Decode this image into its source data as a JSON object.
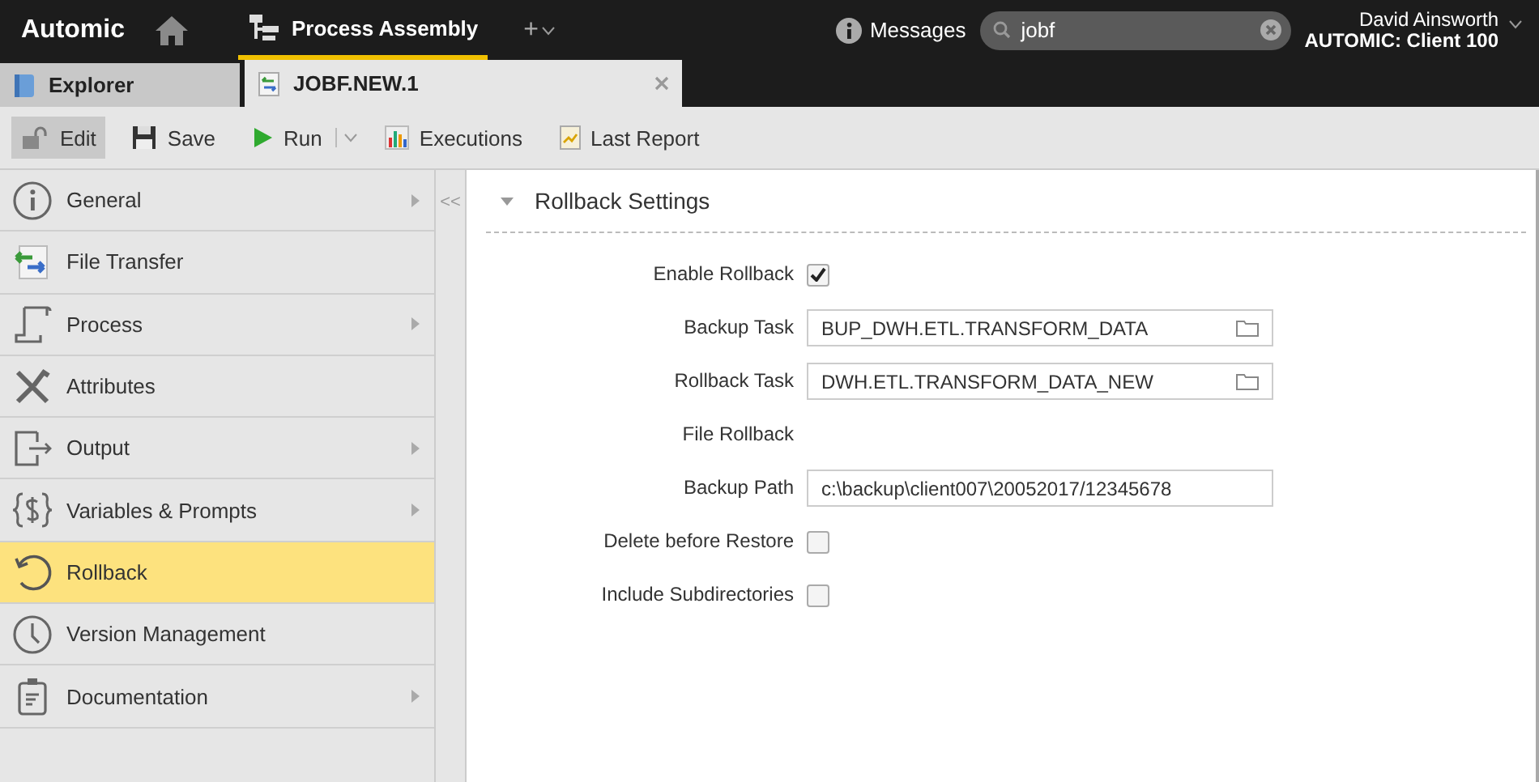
{
  "topbar": {
    "logo": "Automic",
    "perspective": "Process Assembly",
    "add": "+",
    "messages": "Messages",
    "search": {
      "value": "jobf"
    },
    "user": {
      "name": "David Ainsworth",
      "client": "AUTOMIC: Client 100"
    }
  },
  "tabs": [
    {
      "label": "Explorer",
      "selected": false,
      "closable": false
    },
    {
      "label": "JOBF.NEW.1",
      "selected": true,
      "closable": true
    }
  ],
  "toolbar": [
    {
      "label": "Edit",
      "selected": true,
      "dropdown": false
    },
    {
      "label": "Save",
      "selected": false,
      "dropdown": false
    },
    {
      "label": "Run",
      "selected": false,
      "dropdown": true
    },
    {
      "label": "Executions",
      "selected": false,
      "dropdown": false
    },
    {
      "label": "Last Report",
      "selected": false,
      "dropdown": false
    }
  ],
  "sidebar": {
    "items": [
      {
        "label": "General",
        "selected": false,
        "expandable": true
      },
      {
        "label": "File Transfer",
        "selected": false,
        "expandable": false
      },
      {
        "label": "Process",
        "selected": false,
        "expandable": true
      },
      {
        "label": "Attributes",
        "selected": false,
        "expandable": false
      },
      {
        "label": "Output",
        "selected": false,
        "expandable": true
      },
      {
        "label": "Variables & Prompts",
        "selected": false,
        "expandable": true
      },
      {
        "label": "Rollback",
        "selected": true,
        "expandable": false
      },
      {
        "label": "Version Management",
        "selected": false,
        "expandable": false
      },
      {
        "label": "Documentation",
        "selected": false,
        "expandable": true
      }
    ],
    "collapse": "<<"
  },
  "section": {
    "title": "Rollback Settings",
    "expanded": true,
    "rows": [
      {
        "kind": "checkbox",
        "label": "Enable Rollback",
        "checked": true
      },
      {
        "kind": "lookup",
        "label": "Backup Task",
        "value": "BUP_DWH.ETL.TRANSFORM_DATA"
      },
      {
        "kind": "lookup",
        "label": "Rollback Task",
        "value": "DWH.ETL.TRANSFORM_DATA_NEW"
      },
      {
        "kind": "heading",
        "label": "File Rollback"
      },
      {
        "kind": "text",
        "label": "Backup Path",
        "value": "c:\\backup\\client007\\20052017/12345678"
      },
      {
        "kind": "checkbox",
        "label": "Delete before Restore",
        "checked": false
      },
      {
        "kind": "checkbox",
        "label": "Include Subdirectories",
        "checked": false
      }
    ]
  }
}
